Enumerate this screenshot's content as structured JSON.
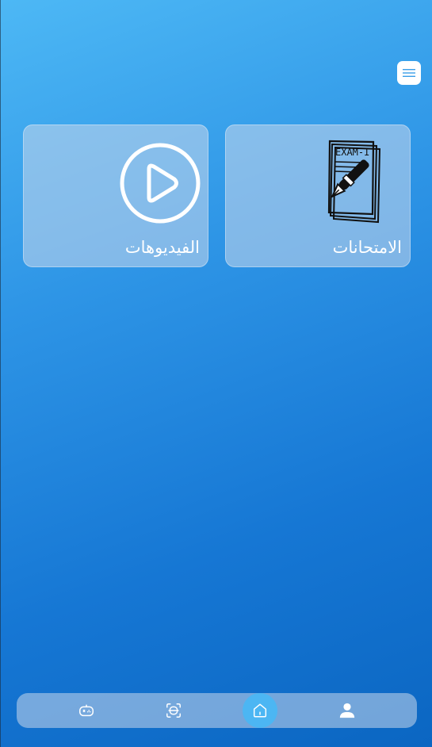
{
  "menu": {
    "icon": "hamburger-icon"
  },
  "cards": [
    {
      "id": "exams",
      "label": "الامتحانات",
      "icon": "exam-paper-pen-icon",
      "icon_text": "EXAM-I"
    },
    {
      "id": "videos",
      "label": "الفيديوهات",
      "icon": "play-circle-icon"
    }
  ],
  "bottom_nav": {
    "items": [
      {
        "id": "games",
        "icon": "gamepad-icon"
      },
      {
        "id": "scan",
        "icon": "scan-icon"
      },
      {
        "id": "home",
        "icon": "home-icon",
        "active": true
      },
      {
        "id": "profile",
        "icon": "user-icon"
      }
    ]
  },
  "colors": {
    "gradient_start": "#4db8f5",
    "gradient_end": "#0b66c2",
    "active_nav": "#4cb6f3",
    "card_bg": "#c8d7eb"
  }
}
